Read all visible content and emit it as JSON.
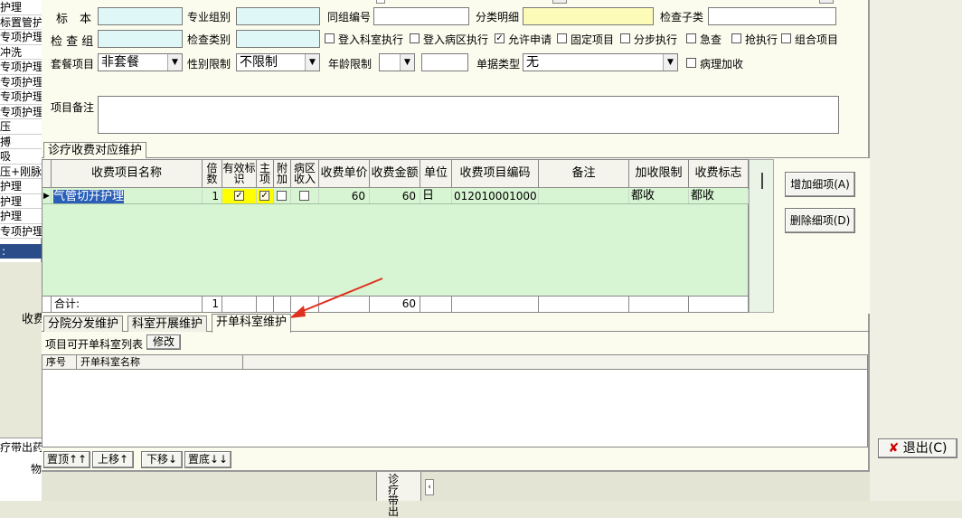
{
  "left_list": [
    "护理",
    "标置管护",
    "专项护理",
    "冲洗",
    "专项护理",
    "专项护理",
    "专项护理",
    "专项护理",
    "压",
    "搏",
    "吸",
    "压+刚脉",
    "护理",
    "护理",
    "护理",
    "专项护理"
  ],
  "left_below": {
    "sep": ":",
    "label1": "收费",
    "label2": "疗带出药",
    "label3": "物"
  },
  "form": {
    "specimen_label": "标　本",
    "specialty_label": "专业组别",
    "group_no_label": "同组编号",
    "category_label": "分类明细",
    "sub_type_label": "检查子类",
    "exam_group_label": "检 查 组",
    "exam_type_label": "检查类别",
    "chk_lab": "登入科室执行",
    "chk_ward": "登入病区执行",
    "chk_allow": "允许申请",
    "chk_fixed": "固定项目",
    "chk_step": "分步执行",
    "chk_urgent": "急查",
    "chk_rescue": "抢执行",
    "chk_combo": "组合项目",
    "package_label": "套餐项目",
    "package_value": "非套餐",
    "gender_label": "性别限制",
    "gender_value": "不限制",
    "age_label": "年龄限制",
    "doc_type_label": "单据类型",
    "doc_type_value": "无",
    "chk_patho": "病理加收",
    "note_label": "项目备注"
  },
  "fee_tab": "诊疗收费对应维护",
  "fee_grid": {
    "headers": [
      "收费项目名称",
      "倍数",
      "有效标识",
      "主项",
      "附加",
      "病区收入",
      "收费单价",
      "收费金额",
      "单位",
      "收费项目编码",
      "备注",
      "加收限制",
      "收费标志"
    ],
    "row": {
      "name": "气管切开护理",
      "mult": "1",
      "price": "60",
      "amount": "60",
      "unit": "日",
      "code": "012010001000",
      "remark": "",
      "limit": "都收",
      "flag": "都收"
    },
    "total_label": "合计:",
    "total_mult": "1",
    "total_amount": "60"
  },
  "buttons": {
    "add": "增加细项(A)",
    "del": "删除细项(D)",
    "exit": "退出(C)",
    "top": "置顶↑↑",
    "up": "上移↑",
    "down": "下移↓",
    "bottom": "置底↓↓",
    "modify": "修改"
  },
  "bottom_tabs": [
    "分院分发维护",
    "科室开展维护",
    "开单科室维护"
  ],
  "dept_list_label": "项目可开单科室列表",
  "dept_grid_headers": [
    "序号",
    "开单科室名称"
  ],
  "taskbar_text": "诊疗带出"
}
